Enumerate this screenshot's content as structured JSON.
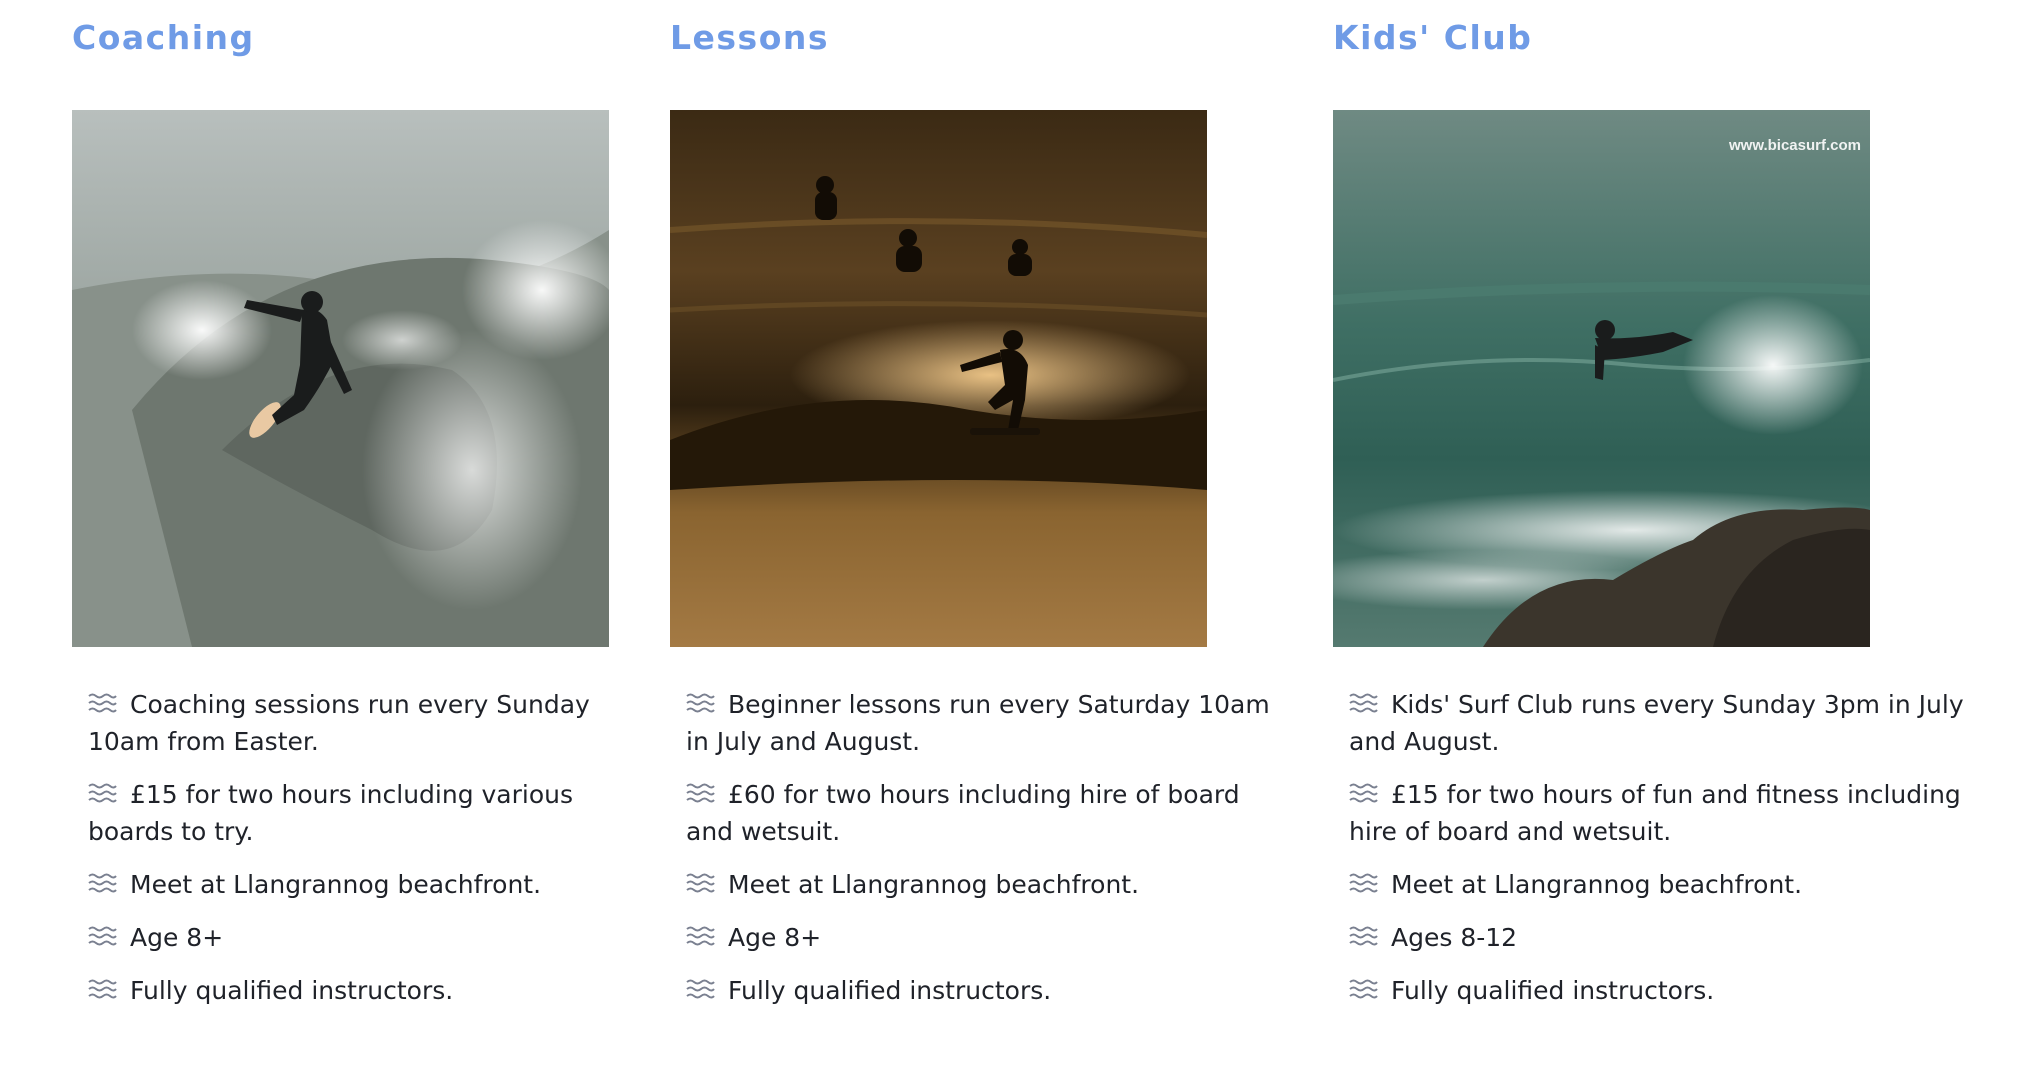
{
  "columns": [
    {
      "title": "Coaching",
      "image_alt": "Surfer carving a turn on a grey wave",
      "items": [
        "Coaching sessions run every Sunday 10am from Easter.",
        "£15 for two hours including various boards to try.",
        "Meet at Llangrannog beachfront.",
        "Age 8+",
        "Fully qualified instructors."
      ]
    },
    {
      "title": "Lessons",
      "image_alt": "Silhouetted surfers at sunset",
      "items": [
        "Beginner lessons run every Saturday 10am in July and August.",
        "£60 for two hours including hire of board and wetsuit.",
        "Meet at Llangrannog beachfront.",
        "Age 8+",
        "Fully qualified instructors."
      ]
    },
    {
      "title": "Kids' Club",
      "image_alt": "Bodyboarder riding a green wave near rocks",
      "watermark": "www.bicasurf.com",
      "items": [
        "Kids' Surf Club runs every Sunday 3pm in July and August.",
        "£15 for two hours of fun and fitness including hire of board and wetsuit.",
        "Meet at Llangrannog beachfront.",
        "Ages 8-12",
        "Fully qualified instructors."
      ]
    }
  ],
  "icons": {
    "list_bullet": "wave-icon"
  },
  "colors": {
    "heading": "#6f9be6",
    "body_text": "#1f2229",
    "wave_icon": "#7a8090"
  }
}
